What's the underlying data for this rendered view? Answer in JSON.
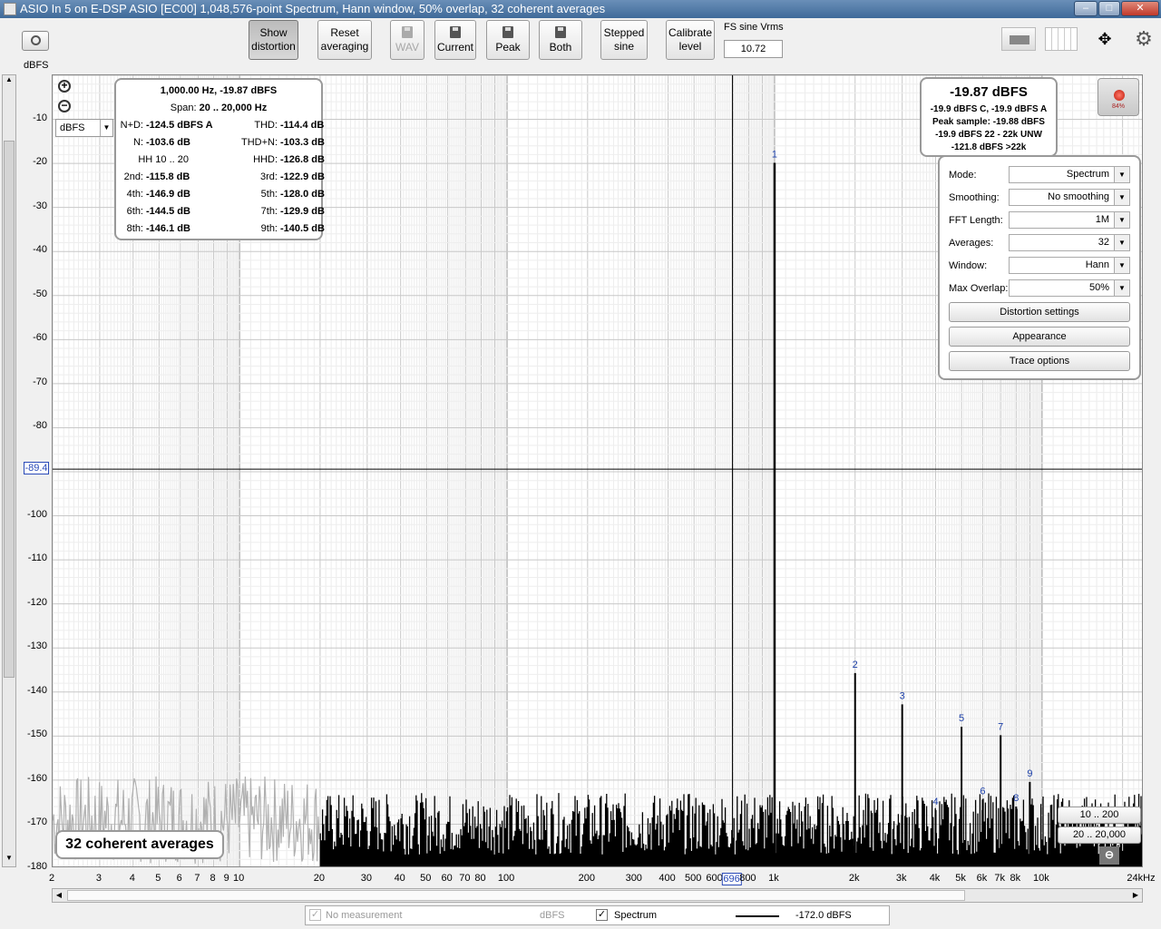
{
  "window": {
    "title": "ASIO In 5 on E-DSP ASIO [EC00] 1,048,576-point Spectrum, Hann window, 50% overlap, 32 coherent averages"
  },
  "toolbar": {
    "show_distortion": [
      "Show",
      "distortion"
    ],
    "reset_averaging": [
      "Reset",
      "averaging"
    ],
    "wav": "WAV",
    "current": "Current",
    "peak": "Peak",
    "both": "Both",
    "stepped_sine": [
      "Stepped",
      "sine"
    ],
    "calibrate_level": [
      "Calibrate",
      "level"
    ],
    "fs_label": "FS sine Vrms",
    "fs_value": "10.72"
  },
  "axis": {
    "y_unit": "dBFS",
    "y_unit_select": "dBFS",
    "x_unit": "24kHz",
    "cursor_y": "-89.4",
    "cursor_x": "696"
  },
  "readout": {
    "header": "1,000.00 Hz, -19.87 dBFS",
    "span_label": "Span:",
    "span_value": "20 .. 20,000 Hz",
    "rows": [
      {
        "l1": "N+D:",
        "v1": "-124.5 dBFS A",
        "l2": "THD:",
        "v2": "-114.4 dB"
      },
      {
        "l1": "N:",
        "v1": "-103.6 dB",
        "l2": "THD+N:",
        "v2": "-103.3 dB"
      },
      {
        "l1": "HH 10 .. 20",
        "v1": "",
        "l2": "HHD:",
        "v2": "-126.8 dB"
      },
      {
        "l1": "2nd:",
        "v1": "-115.8 dB",
        "l2": "3rd:",
        "v2": "-122.9 dB"
      },
      {
        "l1": "4th:",
        "v1": "-146.9 dB",
        "l2": "5th:",
        "v2": "-128.0 dB"
      },
      {
        "l1": "6th:",
        "v1": "-144.5 dB",
        "l2": "7th:",
        "v2": "-129.9 dB"
      },
      {
        "l1": "8th:",
        "v1": "-146.1 dB",
        "l2": "9th:",
        "v2": "-140.5 dB"
      }
    ]
  },
  "level": {
    "main": "-19.87 dBFS",
    "lines": [
      "-19.9 dBFS C, -19.9 dBFS A",
      "Peak sample: -19.88 dBFS",
      "-19.9 dBFS 22 - 22k UNW",
      "-121.8 dBFS >22k"
    ],
    "meter": "84%"
  },
  "controls": [
    {
      "label": "Mode:",
      "value": "Spectrum"
    },
    {
      "label": "Smoothing:",
      "value": "No  smoothing"
    },
    {
      "label": "FFT Length:",
      "value": "1M"
    },
    {
      "label": "Averages:",
      "value": "32"
    },
    {
      "label": "Window:",
      "value": "Hann"
    },
    {
      "label": "Max Overlap:",
      "value": "50%"
    }
  ],
  "buttons": {
    "distortion_settings": "Distortion settings",
    "appearance": "Appearance",
    "trace_options": "Trace options"
  },
  "averages_badge": "32 coherent averages",
  "range_buttons": [
    "10 .. 200",
    "20 .. 20,000"
  ],
  "legend": {
    "no_measurement": "No measurement",
    "no_measurement_unit": "dBFS",
    "spectrum": "Spectrum",
    "spectrum_value": "-172.0 dBFS"
  },
  "chart_data": {
    "type": "line",
    "xlabel": "",
    "ylabel": "dBFS",
    "xscale": "log",
    "xlim": [
      2,
      24000
    ],
    "ylim": [
      -180,
      0
    ],
    "x_ticks": [
      "2",
      "3",
      "4",
      "5",
      "6",
      "7",
      "8",
      "9",
      "10",
      "20",
      "30",
      "40",
      "50",
      "60",
      "70",
      "80",
      "100",
      "200",
      "300",
      "400",
      "500",
      "600",
      "696",
      "800",
      "1k",
      "2k",
      "3k",
      "4k",
      "5k",
      "6k",
      "7k",
      "8k",
      "10k",
      "24kHz"
    ],
    "y_ticks": [
      "-10",
      "-20",
      "-30",
      "-40",
      "-50",
      "-60",
      "-70",
      "-80",
      "-89.4",
      "-100",
      "-110",
      "-120",
      "-130",
      "-140",
      "-150",
      "-160",
      "-170",
      "-180"
    ],
    "series": [
      {
        "name": "Spectrum",
        "peaks": [
          {
            "label": "1",
            "freq": 1000,
            "level": -19.87
          },
          {
            "label": "2",
            "freq": 2000,
            "level": -135.7
          },
          {
            "label": "3",
            "freq": 3000,
            "level": -142.8
          },
          {
            "label": "4",
            "freq": 4000,
            "level": -166.8
          },
          {
            "label": "5",
            "freq": 5000,
            "level": -147.9
          },
          {
            "label": "6",
            "freq": 6000,
            "level": -164.4
          },
          {
            "label": "7",
            "freq": 7000,
            "level": -149.8
          },
          {
            "label": "8",
            "freq": 8000,
            "level": -166.0
          },
          {
            "label": "9",
            "freq": 9000,
            "level": -160.4
          }
        ],
        "noise_floor": -172.0
      }
    ]
  }
}
